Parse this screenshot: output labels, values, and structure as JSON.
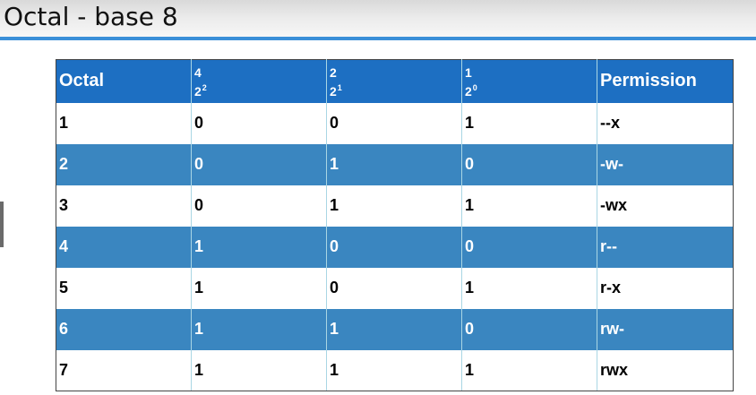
{
  "page": {
    "title": "Octal - base 8"
  },
  "table": {
    "headers": [
      {
        "label": "Octal"
      },
      {
        "weight": "4",
        "base": "2",
        "exp": "2"
      },
      {
        "weight": "2",
        "base": "2",
        "exp": "1"
      },
      {
        "weight": "1",
        "base": "2",
        "exp": "0"
      },
      {
        "label": "Permission"
      }
    ],
    "rows": [
      [
        "1",
        "0",
        "0",
        "1",
        "--x"
      ],
      [
        "2",
        "0",
        "1",
        "0",
        "-w-"
      ],
      [
        "3",
        "0",
        "1",
        "1",
        "-wx"
      ],
      [
        "4",
        "1",
        "0",
        "0",
        "r--"
      ],
      [
        "5",
        "1",
        "0",
        "1",
        "r-x"
      ],
      [
        "6",
        "1",
        "1",
        "0",
        "rw-"
      ],
      [
        "7",
        "1",
        "1",
        "1",
        "rwx"
      ]
    ]
  },
  "colors": {
    "header_bg": "#1d6fc2",
    "stripe_bg": "#3a86c0",
    "title_rule": "#3a8fd8"
  }
}
